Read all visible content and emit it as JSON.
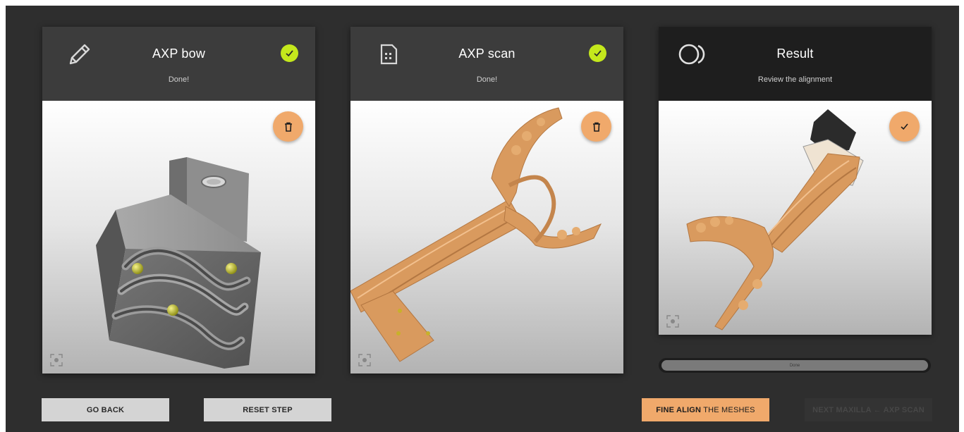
{
  "panels": [
    {
      "title": "AXP bow",
      "subtitle": "Done!",
      "icon": "pencil-icon",
      "status_icon": "check-icon",
      "action_icon": "trash-icon",
      "view_icon": "focus-icon"
    },
    {
      "title": "AXP scan",
      "subtitle": "Done!",
      "icon": "sim-card-icon",
      "status_icon": "check-icon",
      "action_icon": "trash-icon",
      "view_icon": "focus-icon"
    },
    {
      "title": "Result",
      "subtitle": "Review the alignment",
      "icon": "overlap-circles-icon",
      "action_icon": "check-icon",
      "view_icon": "focus-icon"
    }
  ],
  "progress": {
    "label": "Done",
    "value": 1.0
  },
  "buttons": {
    "go_back": "GO BACK",
    "reset_step": "RESET STEP",
    "fine_align_bold": "FINE ALIGN",
    "fine_align_rest": "THE MESHES",
    "next": "NEXT MAXILLA ← AXP SCAN"
  },
  "colors": {
    "background": "#2e2e2e",
    "accent": "#f0a96b",
    "success": "#c4e81c",
    "mesh": "#d99a5e",
    "header": "#3c3c3c",
    "header_active": "#1e1e1e"
  }
}
